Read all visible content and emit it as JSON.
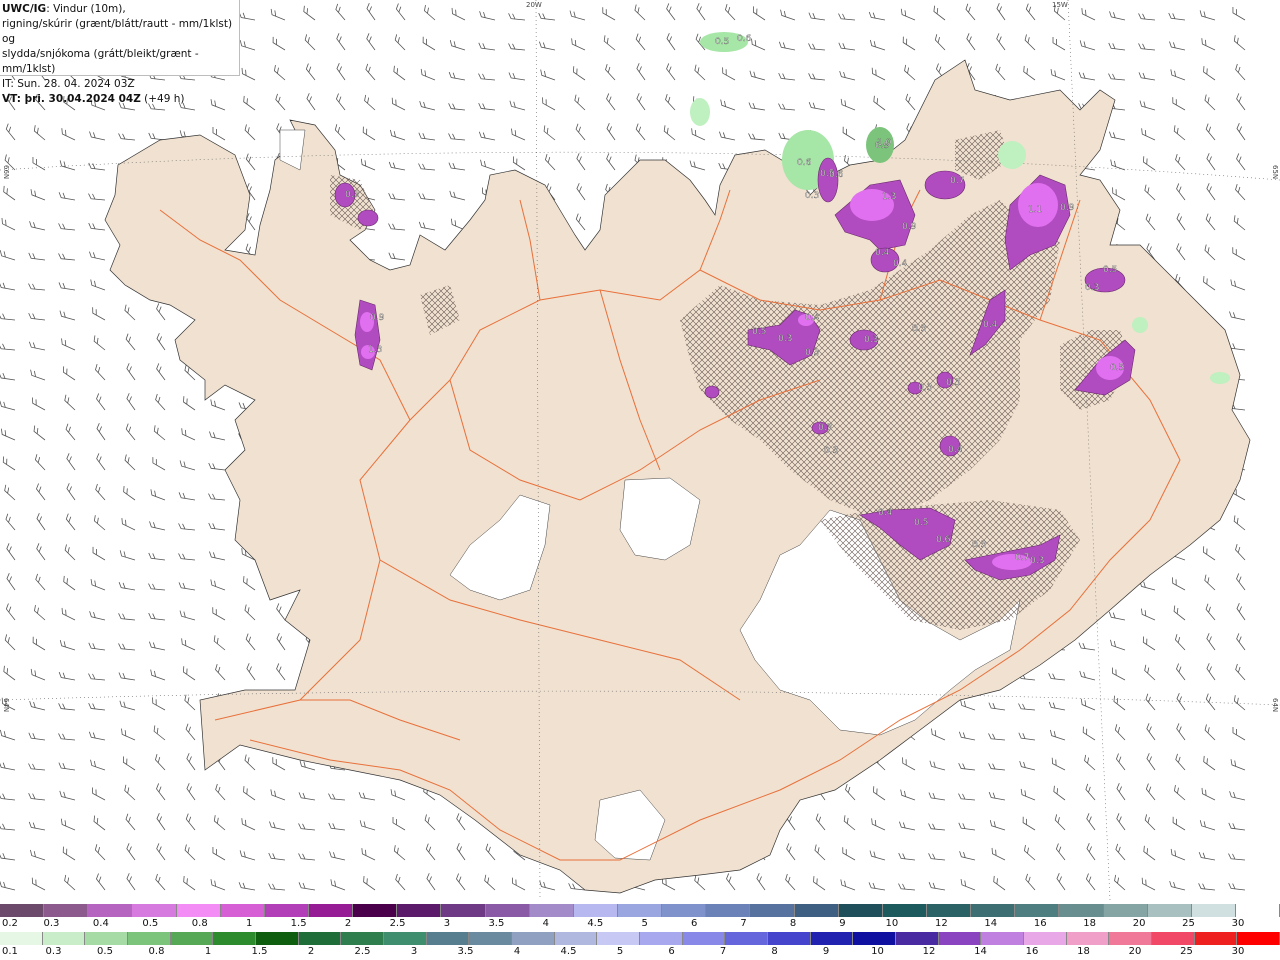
{
  "header": {
    "model": "UWC/IG",
    "desc1": ": Vindur (10m),",
    "desc2": "rigning/skúrir (grænt/blátt/rautt - mm/1klst) og",
    "desc3": "slydda/snjókoma (grátt/bleikt/grænt - mm/1klst)",
    "it_line": "IT: Sun. 28. 04. 2024 03Z",
    "vt_label": "VT: þri. 30.04.2024 04Z",
    "vt_offset": " (+49 h)"
  },
  "graticule": {
    "top_20w": "20W",
    "top_15w": "15W",
    "left_66n": "66N",
    "left_64n": "64N",
    "right_65n": "65N",
    "right_64n": "64N"
  },
  "map_values": [
    "0.5",
    "0.6",
    "0.6",
    "0.5",
    "0.3",
    "0.9",
    "1.0",
    "0.6",
    "0.3",
    "1.3",
    "0.9",
    "0.4",
    "0.4",
    "0.7",
    "1.1",
    "0.9",
    "0.4",
    "0.5",
    "0.3",
    "0.3",
    "0.4",
    "0.3",
    "0.5",
    "0.3",
    "0.3",
    "0.3",
    "0.3",
    "0.3",
    "0.3",
    "0.4",
    "0.5",
    "0.9",
    "1.3",
    "0.4",
    "0.5",
    "0.6",
    "0.3",
    "0.7",
    "0.3"
  ],
  "colors": {
    "sea": "#ffffff",
    "land": "#f0e1d0",
    "glacier": "#ffffff",
    "roads": "#e8703a",
    "wind_barbs": "#555555",
    "snow_purple": "#b04cc0",
    "rain_green": "#9fdc9f"
  },
  "legend_snow": {
    "colors": [
      "#6b4a6b",
      "#8c5a8c",
      "#b565c0",
      "#d77ae0",
      "#f38cf5",
      "#d65fd6",
      "#b33fb8",
      "#951c95",
      "#4b004b",
      "#5c1a6a",
      "#6e3a86",
      "#8a5aa6",
      "#a38ac8",
      "#b8b8f0",
      "#9aa6e0",
      "#8092cc",
      "#6a82b8",
      "#5872a0",
      "#3e5e82",
      "#1f4f5a",
      "#1c5a5e",
      "#2a6266",
      "#3d6f72",
      "#4f7e80",
      "#688e8f",
      "#85a5a5",
      "#a8c0c0",
      "#d0e0e0",
      "#ffffff"
    ],
    "labels": [
      "0.2",
      "0.3",
      "0.4",
      "0.5",
      "0.8",
      "1",
      "1.5",
      "2",
      "2.5",
      "3",
      "3.5",
      "4",
      "4.5",
      "5",
      "6",
      "7",
      "8",
      "9",
      "10",
      "12",
      "14",
      "16",
      "18",
      "20",
      "25",
      "30"
    ]
  },
  "legend_rain": {
    "colors": [
      "#e6f7e6",
      "#c9ecc9",
      "#a6dba6",
      "#7cc47c",
      "#56a856",
      "#2d8a2d",
      "#0f5e0f",
      "#1f6e3a",
      "#2f7e4e",
      "#3f8e6e",
      "#567e8e",
      "#6a8aa0",
      "#90a0c0",
      "#b0b8e0",
      "#c8c8f5",
      "#a8a8ee",
      "#8888e8",
      "#6666dc",
      "#4444cc",
      "#2222b0",
      "#1010a0",
      "#4a2aa0",
      "#8a44c0",
      "#c080e0",
      "#e8a8e8",
      "#f0a0c8",
      "#f07898",
      "#f04866",
      "#ee2020",
      "#ff0000"
    ],
    "labels": [
      "0.1",
      "0.3",
      "0.5",
      "0.8",
      "1",
      "1.5",
      "2",
      "2.5",
      "3",
      "3.5",
      "4",
      "4.5",
      "5",
      "6",
      "7",
      "8",
      "9",
      "10",
      "12",
      "14",
      "16",
      "18",
      "20",
      "25",
      "30"
    ]
  }
}
